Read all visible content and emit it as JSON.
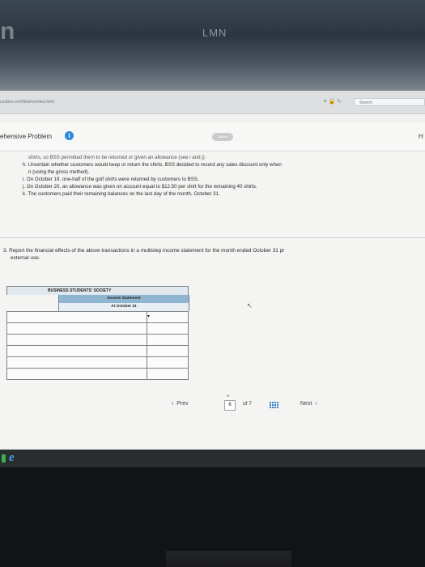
{
  "browser": {
    "url": "ucation.com/flow/connect.html",
    "search_placeholder": "Search"
  },
  "header": {
    "title": "ehensive Problem",
    "saved_label": "Saved",
    "help_letter": "H"
  },
  "problem": {
    "cut_line": "shirts, so BSS permitted them to be returned or given an allowance (see i and j).",
    "item_h": "h. Uncertain whether customers would keep or return the shirts, BSS decided to record any sales discount only when",
    "item_h2": "n (using the gross method).",
    "item_i": "i. On October 19, one-half of the golf shirts were returned by customers to BSS.",
    "item_j": "j. On October 20, an allowance was given on account equal to $12.50 per shirt for the remaining 40 shirts.",
    "item_k": "k. The customers paid their remaining balances on the last day of the month, October 31."
  },
  "question": {
    "text": "3. Report the financial effects of the above transactions in a multistep income statement for the month ended October 31 pr",
    "text2": "external use."
  },
  "statement": {
    "company": "BUSINESS STUDENTS' SOCIETY",
    "title": "Income Statement",
    "period": "At October 31"
  },
  "pager": {
    "prev_label": "Prev",
    "current_page": "6",
    "of_label": "of 7",
    "next_label": "Next"
  }
}
